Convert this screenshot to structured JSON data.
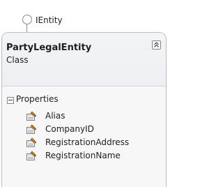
{
  "interface": {
    "name": "IEntity",
    "icon": "lollipop-interface-icon"
  },
  "class_shape": {
    "name": "PartyLegalEntity",
    "kind": "Class",
    "collapse_icon": "double-chevron-up-icon"
  },
  "compartment": {
    "label": "Properties",
    "toggle_icon": "collapse-minus-icon",
    "items": [
      {
        "label": "Alias",
        "icon": "property-icon"
      },
      {
        "label": "CompanyID",
        "icon": "property-icon"
      },
      {
        "label": "RegistrationAddress",
        "icon": "property-icon"
      },
      {
        "label": "RegistrationName",
        "icon": "property-icon"
      }
    ]
  },
  "colors": {
    "border": "#b8bcc3",
    "header_bg": "#f1f2f5",
    "body_bg": "#f7f7f8",
    "text": "#1e1e1e"
  }
}
